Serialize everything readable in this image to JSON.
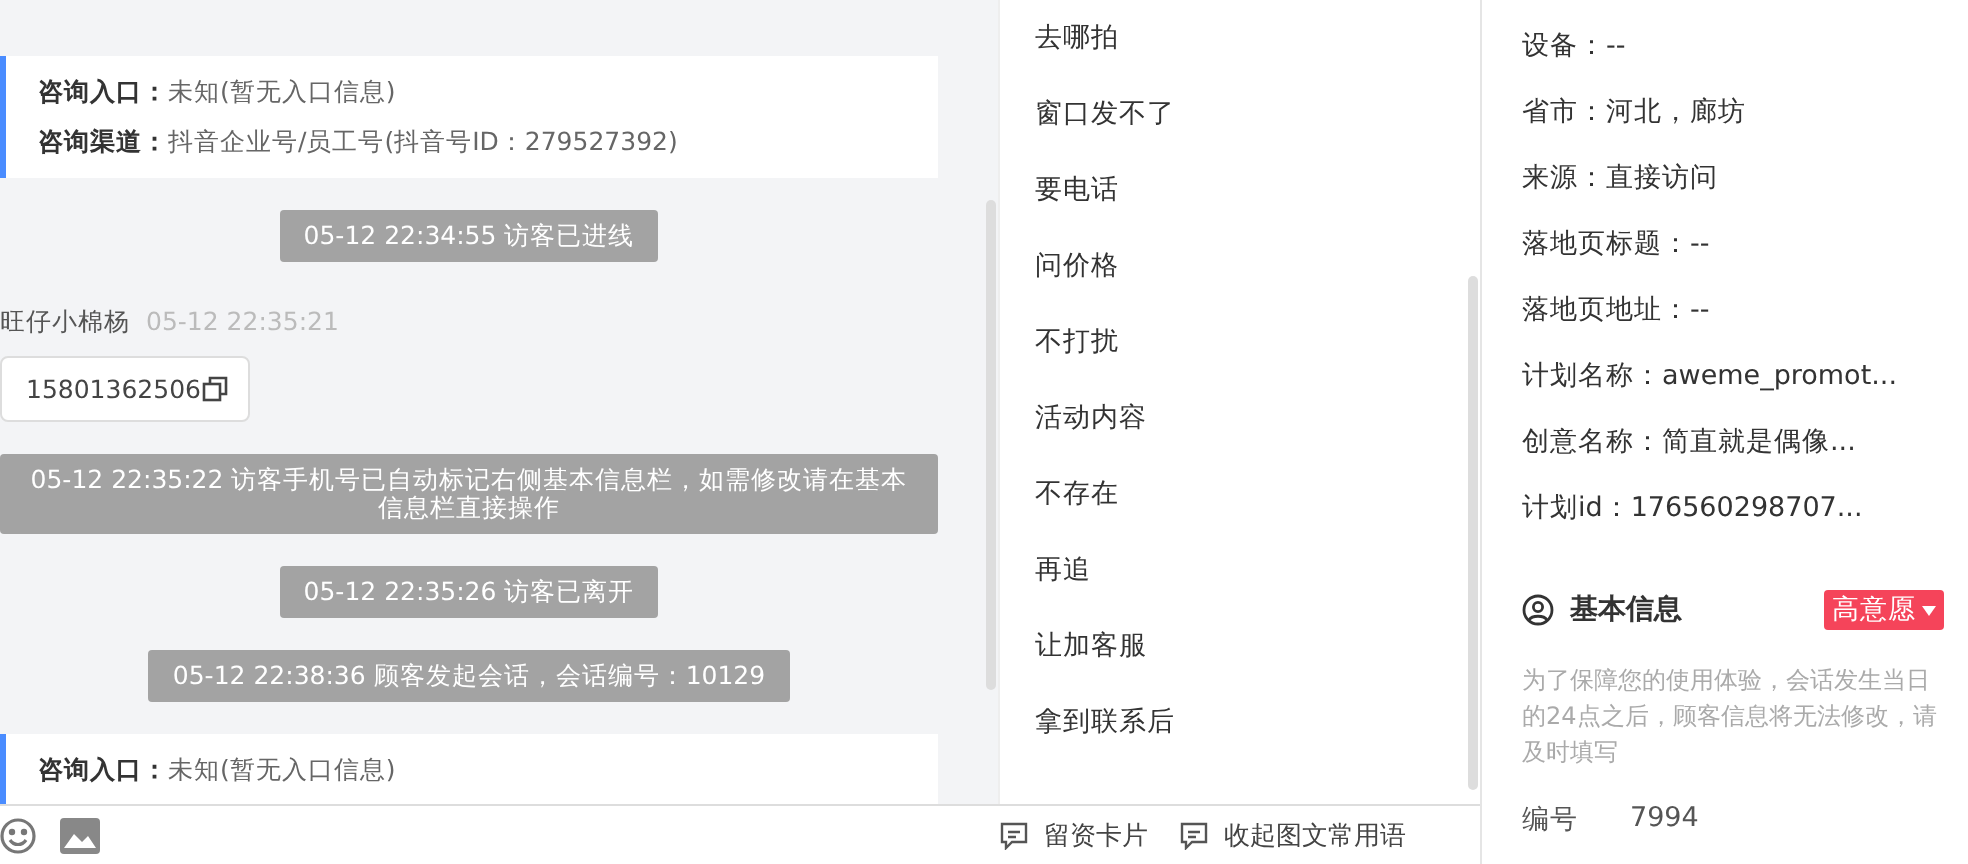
{
  "chat": {
    "messages": [
      {
        "kind": "info",
        "rows": [
          {
            "label": "咨询入口：",
            "value": "未知(暂无入口信息)"
          },
          {
            "label": "咨询渠道：",
            "value": "抖音企业号/员工号(抖音号ID：279527392)"
          }
        ]
      },
      {
        "kind": "system",
        "text": "05-12 22:34:55 访客已进线"
      },
      {
        "kind": "visitor",
        "name": "旺仔小棉杨",
        "time": "05-12 22:35:21",
        "text": "15801362506"
      },
      {
        "kind": "system",
        "text": "05-12 22:35:22 访客手机号已自动标记右侧基本信息栏，如需修改请在基本信息栏直接操作"
      },
      {
        "kind": "system",
        "text": "05-12 22:35:26 访客已离开"
      },
      {
        "kind": "system",
        "text": "05-12 22:38:36 顾客发起会话，会话编号：10129"
      },
      {
        "kind": "info",
        "rows": [
          {
            "label": "咨询入口：",
            "value": "未知(暂无入口信息)"
          }
        ]
      }
    ]
  },
  "quick_replies": [
    "去哪拍",
    "窗口发不了",
    "要电话",
    "问价格",
    "不打扰",
    "活动内容",
    "不存在",
    "再追",
    "让加客服",
    "拿到联系后"
  ],
  "toolbar": {
    "buttons": [
      "留资卡片",
      "收起图文常用语"
    ]
  },
  "visitor_info": {
    "fields": [
      "设备：--",
      "省市：河北，廊坊",
      "来源：直接访问",
      "落地页标题：--",
      "落地页地址：--",
      "计划名称：aweme_promot...",
      "创意名称：简直就是偶像...",
      "计划id：176560298707..."
    ]
  },
  "basic_info": {
    "title": "基本信息",
    "tag": "高意愿",
    "notice": "为了保障您的使用体验，会话发生当日的24点之后，顾客信息将无法修改，请及时填写",
    "fields": [
      {
        "label": "编号",
        "value": "7994"
      }
    ]
  }
}
